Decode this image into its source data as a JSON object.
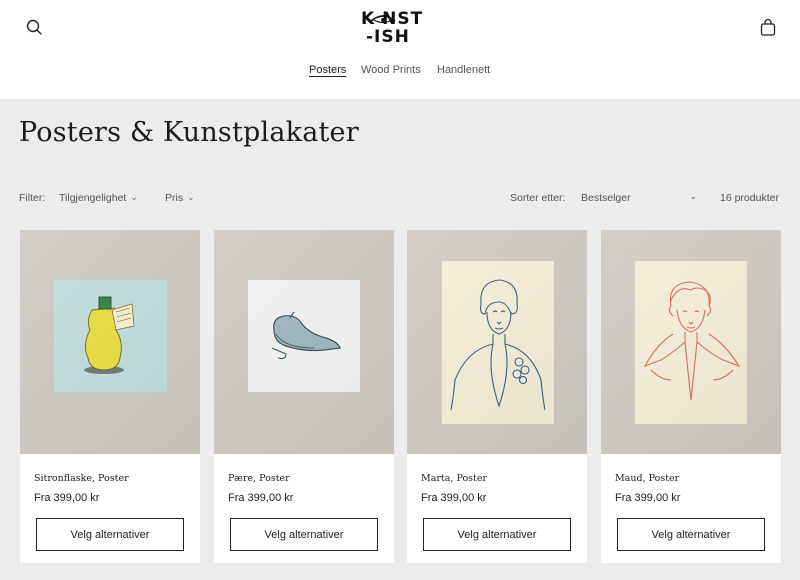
{
  "brand": {
    "logo_line1": "K NST",
    "logo_line2": "-ISH"
  },
  "header": {
    "search_icon": "search-icon",
    "cart_icon": "bag-icon"
  },
  "nav": [
    {
      "label": "Posters",
      "active": true
    },
    {
      "label": "Wood Prints",
      "active": false
    },
    {
      "label": "Handlenett",
      "active": false
    }
  ],
  "collection": {
    "title": "Posters & Kunstplakater"
  },
  "filters": {
    "label": "Filter:",
    "availability": "Tilgjengelighet",
    "price": "Pris",
    "sort_label": "Sorter etter:",
    "sort_value": "Bestselger",
    "count": "16 produkter"
  },
  "products": [
    {
      "name": "Sitronflaske, Poster",
      "price": "Fra 399,00 kr",
      "button": "Velg alternativer"
    },
    {
      "name": "Pære, Poster",
      "price": "Fra 399,00 kr",
      "button": "Velg alternativer"
    },
    {
      "name": "Marta, Poster",
      "price": "Fra 399,00 kr",
      "button": "Velg alternativer"
    },
    {
      "name": "Maud, Poster",
      "price": "Fra 399,00 kr",
      "button": "Velg alternativer"
    }
  ],
  "colors": {
    "page_bg": "#ececec",
    "card_image_bg": "#cdc8c0",
    "text": "#222222"
  }
}
